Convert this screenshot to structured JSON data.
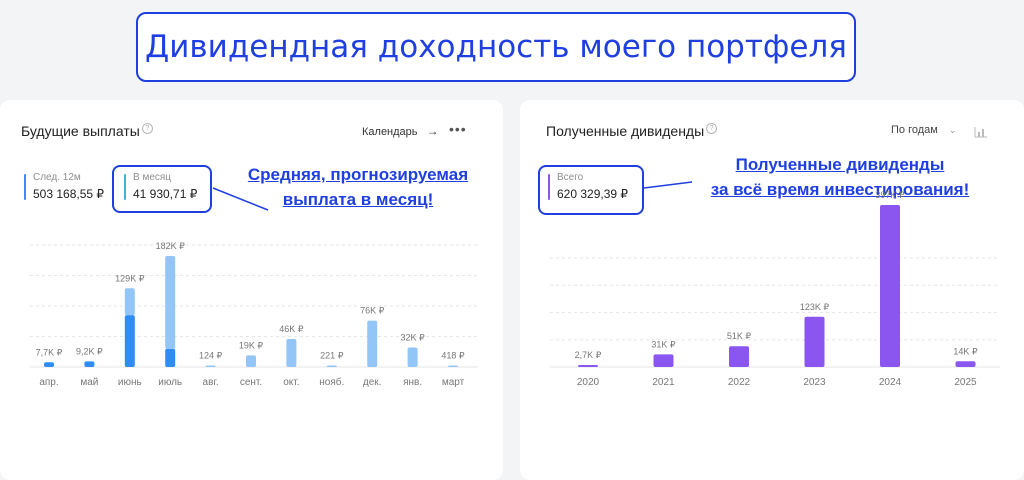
{
  "banner": {
    "title": "Дивидендная доходность моего портфеля"
  },
  "future_panel": {
    "title": "Будущие выплаты",
    "help_icon": "question-circle-icon",
    "view_label": "Календарь",
    "view_icon": "arrow-right-icon",
    "more_icon": "more-dots-icon",
    "stats": [
      {
        "label": "След. 12м",
        "value": "503 168,55 ₽",
        "color": "#3a8df5"
      },
      {
        "label": "В месяц",
        "value": "41 930,71 ₽",
        "color": "#3ab5d8"
      }
    ],
    "annotation": [
      "Средняя, прогнозируемая",
      "выплата в месяц!"
    ]
  },
  "received_panel": {
    "title": "Полученные дивиденды",
    "help_icon": "question-circle-icon",
    "period_label": "По годам",
    "period_icon": "chevron-down-icon",
    "chart_icon": "bar-chart-icon",
    "stats": [
      {
        "label": "Всего",
        "value": "620 329,39 ₽",
        "color": "#8b55f0"
      }
    ],
    "annotation": [
      "Полученные дивиденды",
      "за всё время инвестирования!"
    ]
  },
  "colors": {
    "accent_blue": "#1f3fe0",
    "bar_light": "#93c6f7",
    "bar_dark": "#2f8cf2",
    "bar_purple": "#8b55f0"
  },
  "chart_data": [
    {
      "type": "bar",
      "categories": [
        "апр.",
        "май",
        "июнь",
        "июль",
        "авг.",
        "сент.",
        "окт.",
        "нояб.",
        "дек.",
        "янв.",
        "март"
      ],
      "data_labels": [
        "7,7K ₽",
        "9,2K ₽",
        "129K ₽",
        "182K ₽",
        "124 ₽",
        "19K ₽",
        "46K ₽",
        "221 ₽",
        "76K ₽",
        "32K ₽",
        "418 ₽"
      ],
      "series": [
        {
          "values": [
            7700,
            9200,
            85000,
            30000,
            0,
            0,
            0,
            0,
            0,
            0,
            0
          ]
        },
        {
          "values": [
            0,
            0,
            44000,
            152000,
            124,
            19000,
            46000,
            221,
            76000,
            32000,
            418
          ]
        }
      ],
      "totals": [
        7700,
        9200,
        129000,
        182000,
        124,
        19000,
        46000,
        221,
        76000,
        32000,
        418
      ],
      "stacked": true,
      "ylim": [
        0,
        200000
      ],
      "grid": true
    },
    {
      "type": "bar",
      "categories": [
        "2020",
        "2021",
        "2022",
        "2023",
        "2024",
        "2025"
      ],
      "data_labels": [
        "2,7K ₽",
        "31K ₽",
        "51K ₽",
        "123K ₽",
        "397K ₽",
        "14K ₽"
      ],
      "values": [
        2700,
        31000,
        51000,
        123000,
        397000,
        14000
      ],
      "ylim": [
        0,
        420000
      ],
      "grid": true
    }
  ]
}
